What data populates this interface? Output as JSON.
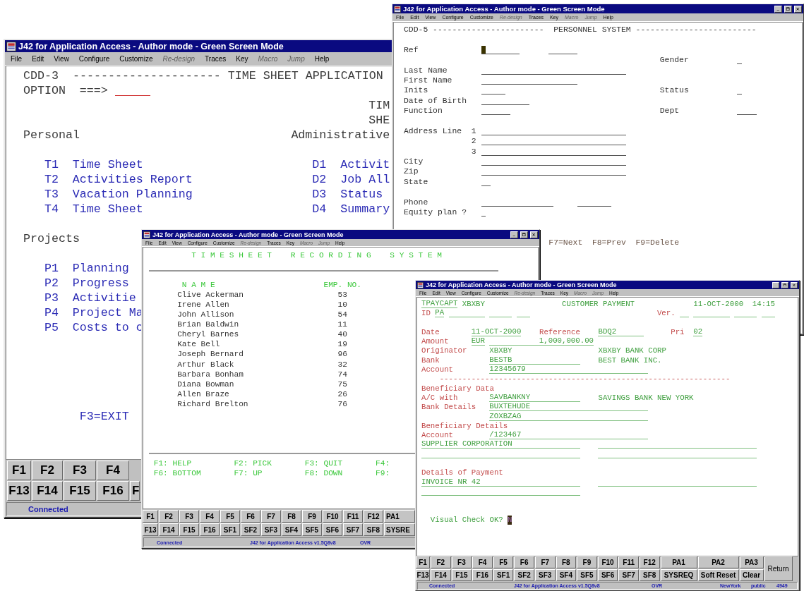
{
  "windows": [
    {
      "title": "J42 for Application Access - Author mode - Green Screen Mode",
      "menu": [
        {
          "label": "File",
          "disabled": false
        },
        {
          "label": "Edit",
          "disabled": false
        },
        {
          "label": "View",
          "disabled": false
        },
        {
          "label": "Configure",
          "disabled": false
        },
        {
          "label": "Customize",
          "disabled": false
        },
        {
          "label": "Re-design",
          "disabled": true
        },
        {
          "label": "Traces",
          "disabled": false
        },
        {
          "label": "Key",
          "disabled": false
        },
        {
          "label": "Macro",
          "disabled": true
        },
        {
          "label": "Jump",
          "disabled": true
        },
        {
          "label": "Help",
          "disabled": false
        }
      ],
      "screen": [
        {
          "cells": [
            {
              "kind": "text",
              "text": "CDD-3  --------------------- TIME SHEET APPLICATION"
            }
          ]
        },
        {
          "cells": [
            {
              "kind": "text",
              "text": "OPTION"
            },
            {
              "kind": "text",
              "text": "===>"
            },
            {
              "kind": "field"
            }
          ]
        },
        {
          "cells": [
            {
              "kind": "text",
              "text": "TIM"
            }
          ]
        },
        {
          "cells": [
            {
              "kind": "text",
              "text": "SHE"
            }
          ]
        },
        {
          "cells": [
            {
              "kind": "text",
              "text": "Personal"
            },
            {
              "kind": "text",
              "text": "Administrative"
            }
          ]
        },
        {
          "cells": [
            {
              "kind": "option",
              "text": "T1"
            },
            {
              "kind": "option",
              "text": "Time Sheet"
            },
            {
              "kind": "option",
              "text": "D1"
            },
            {
              "kind": "option",
              "text": "Activit"
            }
          ]
        },
        {
          "cells": [
            {
              "kind": "option",
              "text": "T2"
            },
            {
              "kind": "option",
              "text": "Activities Report"
            },
            {
              "kind": "option",
              "text": "D2"
            },
            {
              "kind": "option",
              "text": "Job All"
            }
          ]
        },
        {
          "cells": [
            {
              "kind": "option",
              "text": "T3"
            },
            {
              "kind": "option",
              "text": "Vacation Planning"
            },
            {
              "kind": "option",
              "text": "D3"
            },
            {
              "kind": "option",
              "text": "Status"
            }
          ]
        },
        {
          "cells": [
            {
              "kind": "option",
              "text": "T4"
            },
            {
              "kind": "option",
              "text": "Time Sheet"
            },
            {
              "kind": "option",
              "text": "D4"
            },
            {
              "kind": "option",
              "text": "Summary"
            }
          ]
        },
        {
          "cells": [
            {
              "kind": "text",
              "text": "Projects"
            }
          ]
        },
        {
          "cells": [
            {
              "kind": "option",
              "text": "P1"
            },
            {
              "kind": "option",
              "text": "Planning"
            }
          ]
        },
        {
          "cells": [
            {
              "kind": "option",
              "text": "P2"
            },
            {
              "kind": "option",
              "text": "Progress"
            }
          ]
        },
        {
          "cells": [
            {
              "kind": "option",
              "text": "P3"
            },
            {
              "kind": "option",
              "text": "Activitie"
            }
          ]
        },
        {
          "cells": [
            {
              "kind": "option",
              "text": "P4"
            },
            {
              "kind": "option",
              "text": "Project Ma"
            }
          ]
        },
        {
          "cells": [
            {
              "kind": "option",
              "text": "P5"
            },
            {
              "kind": "option",
              "text": "Costs to c"
            }
          ]
        },
        {
          "cells": [
            {
              "kind": "option",
              "text": "F3=EXIT"
            }
          ]
        }
      ],
      "keys": [
        [
          "F1",
          "F2",
          "F3",
          "F4"
        ],
        [
          "F13",
          "F14",
          "F15",
          "F16",
          "F"
        ]
      ],
      "status": [
        "Connected"
      ]
    },
    {
      "title": "J42 for Application Access - Author mode - Green Screen Mode",
      "menu": [
        {
          "label": "File",
          "disabled": false
        },
        {
          "label": "Edit",
          "disabled": false
        },
        {
          "label": "View",
          "disabled": false
        },
        {
          "label": "Configure",
          "disabled": false
        },
        {
          "label": "Customize",
          "disabled": false
        },
        {
          "label": "Re-design",
          "disabled": true
        },
        {
          "label": "Traces",
          "disabled": false
        },
        {
          "label": "Key",
          "disabled": false
        },
        {
          "label": "Macro",
          "disabled": true
        },
        {
          "label": "Jump",
          "disabled": true
        },
        {
          "label": "Help",
          "disabled": false
        }
      ],
      "screen": [
        {
          "cells": [
            {
              "kind": "text",
              "text": "CDD-5 -----------------------  PERSONNEL SYSTEM -------------------------"
            }
          ]
        },
        {
          "cells": [
            {
              "kind": "text",
              "text": "Ref"
            },
            {
              "kind": "cursor_field"
            },
            {
              "kind": "field"
            }
          ]
        },
        {
          "cells": [
            {
              "kind": "text",
              "text": "Gender"
            },
            {
              "kind": "field"
            }
          ]
        },
        {
          "cells": [
            {
              "kind": "text",
              "text": "Last Name"
            },
            {
              "kind": "field"
            }
          ]
        },
        {
          "cells": [
            {
              "kind": "text",
              "text": "First Name"
            },
            {
              "kind": "field"
            }
          ]
        },
        {
          "cells": [
            {
              "kind": "text",
              "text": "Inits"
            },
            {
              "kind": "field"
            },
            {
              "kind": "text",
              "text": "Status"
            },
            {
              "kind": "field"
            }
          ]
        },
        {
          "cells": [
            {
              "kind": "text",
              "text": "Date of Birth"
            },
            {
              "kind": "field"
            }
          ]
        },
        {
          "cells": [
            {
              "kind": "text",
              "text": "Function"
            },
            {
              "kind": "field"
            },
            {
              "kind": "text",
              "text": "Dept"
            },
            {
              "kind": "field"
            }
          ]
        },
        {
          "cells": [
            {
              "kind": "text",
              "text": "Address Line"
            },
            {
              "kind": "text",
              "text": "1"
            },
            {
              "kind": "field"
            }
          ]
        },
        {
          "cells": [
            {
              "kind": "text",
              "text": "2"
            },
            {
              "kind": "field"
            }
          ]
        },
        {
          "cells": [
            {
              "kind": "text",
              "text": "3"
            },
            {
              "kind": "field"
            }
          ]
        },
        {
          "cells": [
            {
              "kind": "text",
              "text": "City"
            },
            {
              "kind": "field"
            }
          ]
        },
        {
          "cells": [
            {
              "kind": "text",
              "text": "Zip"
            },
            {
              "kind": "field"
            }
          ]
        },
        {
          "cells": [
            {
              "kind": "text",
              "text": "State"
            },
            {
              "kind": "field"
            }
          ]
        },
        {
          "cells": [
            {
              "kind": "text",
              "text": "Phone"
            },
            {
              "kind": "field"
            },
            {
              "kind": "field"
            }
          ]
        },
        {
          "cells": [
            {
              "kind": "text",
              "text": "Equity plan ?"
            },
            {
              "kind": "field"
            }
          ]
        },
        {
          "cells": [
            {
              "kind": "keyhint",
              "text": "F7=Next  F8=Prev  F9=Delete"
            }
          ]
        }
      ]
    },
    {
      "title": "J42 for Application Access - Author mode - Green Screen Mode",
      "menu": [
        {
          "label": "File",
          "disabled": false
        },
        {
          "label": "Edit",
          "disabled": false
        },
        {
          "label": "View",
          "disabled": false
        },
        {
          "label": "Configure",
          "disabled": false
        },
        {
          "label": "Customize",
          "disabled": false
        },
        {
          "label": "Re-design",
          "disabled": true
        },
        {
          "label": "Traces",
          "disabled": false
        },
        {
          "label": "Key",
          "disabled": false
        },
        {
          "label": "Macro",
          "disabled": true
        },
        {
          "label": "Jump",
          "disabled": true
        },
        {
          "label": "Help",
          "disabled": false
        }
      ],
      "screen": [
        {
          "cells": [
            {
              "kind": "title",
              "text": "T I M E S H E E T    R E C O R D I N G    S Y S T E M"
            }
          ]
        },
        {
          "cells": [
            {
              "kind": "heading",
              "text": "N A M E"
            },
            {
              "kind": "heading",
              "text": "EMP. NO."
            }
          ]
        },
        {
          "cells": [
            {
              "kind": "text",
              "text": "Clive Ackerman"
            },
            {
              "kind": "text",
              "text": "53"
            }
          ]
        },
        {
          "cells": [
            {
              "kind": "text",
              "text": "Irene Allen"
            },
            {
              "kind": "text",
              "text": "10"
            }
          ]
        },
        {
          "cells": [
            {
              "kind": "text",
              "text": "John Allison"
            },
            {
              "kind": "text",
              "text": "54"
            }
          ]
        },
        {
          "cells": [
            {
              "kind": "text",
              "text": "Brian Baldwin"
            },
            {
              "kind": "text",
              "text": "11"
            }
          ]
        },
        {
          "cells": [
            {
              "kind": "text",
              "text": "Cheryl Barnes"
            },
            {
              "kind": "text",
              "text": "40"
            }
          ]
        },
        {
          "cells": [
            {
              "kind": "text",
              "text": "Kate Bell"
            },
            {
              "kind": "text",
              "text": "19"
            }
          ]
        },
        {
          "cells": [
            {
              "kind": "text",
              "text": "Joseph Bernard"
            },
            {
              "kind": "text",
              "text": "96"
            }
          ]
        },
        {
          "cells": [
            {
              "kind": "text",
              "text": "Arthur Black"
            },
            {
              "kind": "text",
              "text": "32"
            }
          ]
        },
        {
          "cells": [
            {
              "kind": "text",
              "text": "Barbara Bonham"
            },
            {
              "kind": "text",
              "text": "74"
            }
          ]
        },
        {
          "cells": [
            {
              "kind": "text",
              "text": "Diana Bowman"
            },
            {
              "kind": "text",
              "text": "75"
            }
          ]
        },
        {
          "cells": [
            {
              "kind": "text",
              "text": "Allen Braze"
            },
            {
              "kind": "text",
              "text": "26"
            }
          ]
        },
        {
          "cells": [
            {
              "kind": "text",
              "text": "Richard Brelton"
            },
            {
              "kind": "text",
              "text": "76"
            }
          ]
        },
        {
          "cells": [
            {
              "kind": "keyhint",
              "text": "F1: HELP"
            },
            {
              "kind": "keyhint",
              "text": "F2: PICK"
            },
            {
              "kind": "keyhint",
              "text": "F3: QUIT"
            },
            {
              "kind": "keyhint",
              "text": "F4:"
            }
          ]
        },
        {
          "cells": [
            {
              "kind": "keyhint",
              "text": "F6: BOTTOM"
            },
            {
              "kind": "keyhint",
              "text": "F7: UP"
            },
            {
              "kind": "keyhint",
              "text": "F8: DOWN"
            },
            {
              "kind": "keyhint",
              "text": "F9:"
            }
          ]
        }
      ],
      "keys": [
        [
          "F1",
          "F2",
          "F3",
          "F4",
          "F5",
          "F6",
          "F7",
          "F8",
          "F9",
          "F10",
          "F11",
          "F12",
          "PA1"
        ],
        [
          "F13",
          "F14",
          "F15",
          "F16",
          "SF1",
          "SF2",
          "SF3",
          "SF4",
          "SF5",
          "SF6",
          "SF7",
          "SF8",
          "SYSRE"
        ]
      ],
      "status": [
        "Connected",
        "J42 for Application Access v1.5Q8v8",
        "OVR"
      ]
    },
    {
      "title": "J42 for Application Access - Author mode - Green Screen Mode",
      "menu": [
        {
          "label": "File",
          "disabled": false
        },
        {
          "label": "Edit",
          "disabled": false
        },
        {
          "label": "View",
          "disabled": false
        },
        {
          "label": "Configure",
          "disabled": false
        },
        {
          "label": "Customize",
          "disabled": false
        },
        {
          "label": "Re-design",
          "disabled": true
        },
        {
          "label": "Traces",
          "disabled": false
        },
        {
          "label": "Key",
          "disabled": false
        },
        {
          "label": "Macro",
          "disabled": true
        },
        {
          "label": "Jump",
          "disabled": true
        },
        {
          "label": "Help",
          "disabled": false
        }
      ],
      "screen": [
        {
          "cells": [
            {
              "kind": "field",
              "text": "TPAYCAPT"
            },
            {
              "kind": "value",
              "text": "XBXBY"
            },
            {
              "kind": "value",
              "text": "CUSTOMER PAYMENT"
            },
            {
              "kind": "value",
              "text": "11-OCT-2000"
            },
            {
              "kind": "value",
              "text": "14:15"
            }
          ]
        },
        {
          "cells": [
            {
              "kind": "label",
              "text": "ID"
            },
            {
              "kind": "field",
              "text": "PA"
            },
            {
              "kind": "field"
            },
            {
              "kind": "field"
            },
            {
              "kind": "field"
            },
            {
              "kind": "label",
              "text": "Ver."
            },
            {
              "kind": "field"
            },
            {
              "kind": "field"
            },
            {
              "kind": "field"
            },
            {
              "kind": "field"
            }
          ]
        },
        {
          "cells": [
            {
              "kind": "label",
              "text": "Date"
            },
            {
              "kind": "field",
              "text": "11-OCT-2000"
            },
            {
              "kind": "label",
              "text": "Reference"
            },
            {
              "kind": "field",
              "text": "BDQ2"
            },
            {
              "kind": "label",
              "text": "Pri"
            },
            {
              "kind": "field",
              "text": "02"
            }
          ]
        },
        {
          "cells": [
            {
              "kind": "label",
              "text": "Amount"
            },
            {
              "kind": "field",
              "text": "EUR"
            },
            {
              "kind": "field",
              "text": "1,000,000.00"
            }
          ]
        },
        {
          "cells": [
            {
              "kind": "label",
              "text": "Originator"
            },
            {
              "kind": "value",
              "text": "XBXBY"
            },
            {
              "kind": "value",
              "text": "XBXBY BANK CORP"
            }
          ]
        },
        {
          "cells": [
            {
              "kind": "label",
              "text": "Bank"
            },
            {
              "kind": "field",
              "text": "BESTB"
            },
            {
              "kind": "value",
              "text": "BEST BANK INC."
            }
          ]
        },
        {
          "cells": [
            {
              "kind": "label",
              "text": "Account"
            },
            {
              "kind": "field",
              "text": "12345679"
            }
          ]
        },
        {
          "cells": [
            {
              "kind": "label",
              "text": "----------------------------------------------------------------"
            }
          ]
        },
        {
          "cells": [
            {
              "kind": "label",
              "text": "Beneficiary Data"
            }
          ]
        },
        {
          "cells": [
            {
              "kind": "label",
              "text": "A/C with"
            },
            {
              "kind": "field",
              "text": "SAVBANKNY"
            },
            {
              "kind": "value",
              "text": "SAVINGS BANK NEW YORK"
            }
          ]
        },
        {
          "cells": [
            {
              "kind": "label",
              "text": "Bank Details"
            },
            {
              "kind": "field",
              "text": "BUXTEHUDE"
            }
          ]
        },
        {
          "cells": [
            {
              "kind": "field",
              "text": "ZOXBZAG"
            }
          ]
        },
        {
          "cells": [
            {
              "kind": "label",
              "text": "Beneficiary Details"
            }
          ]
        },
        {
          "cells": [
            {
              "kind": "label",
              "text": "Account"
            },
            {
              "kind": "field",
              "text": "/123467"
            }
          ]
        },
        {
          "cells": [
            {
              "kind": "field",
              "text": "SUPPLIER CORPORATION"
            },
            {
              "kind": "field"
            }
          ]
        },
        {
          "cells": [
            {
              "kind": "field"
            },
            {
              "kind": "field"
            }
          ]
        },
        {
          "cells": [
            {
              "kind": "label",
              "text": "Details of Payment"
            }
          ]
        },
        {
          "cells": [
            {
              "kind": "field",
              "text": "INVOICE NR 42"
            },
            {
              "kind": "field"
            }
          ]
        },
        {
          "cells": [
            {
              "kind": "field"
            }
          ]
        },
        {
          "cells": [
            {
              "kind": "value",
              "text": "Visual Check OK?"
            },
            {
              "kind": "cursor_value",
              "text": "N"
            }
          ]
        }
      ],
      "keys": [
        [
          "F1",
          "F2",
          "F3",
          "F4",
          "F5",
          "F6",
          "F7",
          "F8",
          "F9",
          "F10",
          "F11",
          "F12",
          "PA1",
          "PA2",
          "PA3"
        ],
        [
          "F13",
          "F14",
          "F15",
          "F16",
          "SF1",
          "SF2",
          "SF3",
          "SF4",
          "SF5",
          "SF6",
          "SF7",
          "SF8",
          "SYSREQ",
          "Soft Reset",
          "Clear"
        ]
      ],
      "side_key": "Return",
      "status": [
        "Connected",
        "J42 for Application Access v1.5Q8v8",
        "OVR",
        "NewYork",
        "public",
        "4949"
      ]
    }
  ]
}
